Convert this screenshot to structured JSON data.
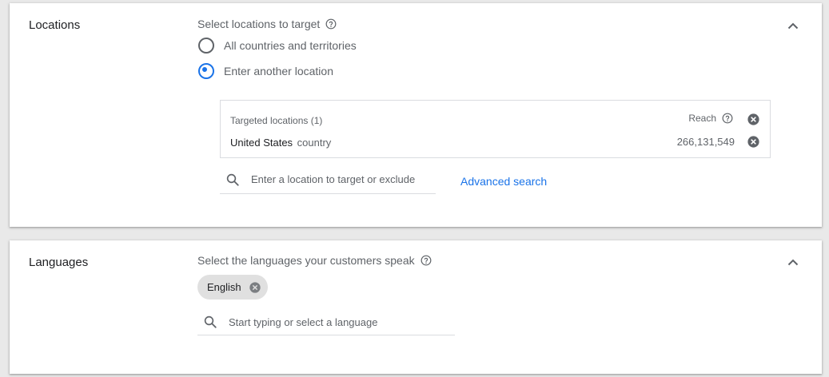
{
  "locations": {
    "title": "Locations",
    "prompt": "Select locations to target",
    "options": [
      {
        "label": "All countries and territories",
        "selected": false
      },
      {
        "label": "Enter another location",
        "selected": true
      }
    ],
    "targeted": {
      "header": "Targeted locations (1)",
      "reach_label": "Reach",
      "rows": [
        {
          "name": "United States",
          "type": "country",
          "reach": "266,131,549"
        }
      ]
    },
    "search": {
      "placeholder": "Enter a location to target or exclude",
      "value": ""
    },
    "advanced_search_label": "Advanced search"
  },
  "languages": {
    "title": "Languages",
    "prompt": "Select the languages your customers speak",
    "chips": [
      {
        "label": "English"
      }
    ],
    "search": {
      "placeholder": "Start typing or select a language",
      "value": ""
    }
  },
  "colors": {
    "accent": "#1a73e8",
    "background": "#e9e9e9",
    "card": "#ffffff",
    "chip": "#e0e0e0"
  }
}
